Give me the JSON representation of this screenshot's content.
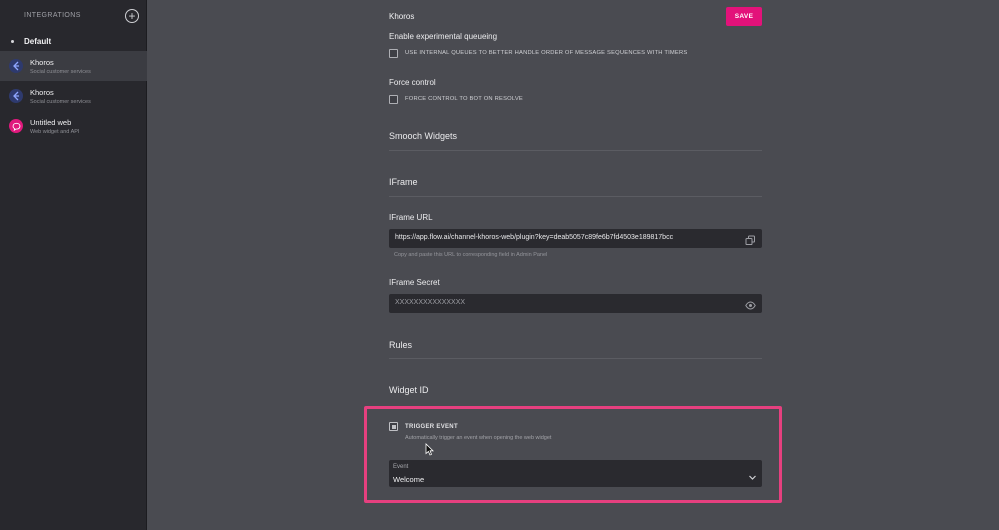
{
  "sidebar": {
    "title": "INTEGRATIONS",
    "add_icon": "plus-circle-icon",
    "group": "Default",
    "items": [
      {
        "name": "Khoros",
        "subtitle": "Social customer services",
        "icon": "khoros-icon",
        "active": true
      },
      {
        "name": "Khoros",
        "subtitle": "Social customer services",
        "icon": "khoros-icon",
        "active": false
      },
      {
        "name": "Untitled web",
        "subtitle": "Web widget and API",
        "icon": "chat-bubble-icon",
        "active": false
      }
    ]
  },
  "header": {
    "title": "Khoros",
    "save_label": "SAVE"
  },
  "queueing": {
    "title": "Enable experimental queueing",
    "checkbox_label": "USE INTERNAL QUEUES TO BETTER HANDLE ORDER OF MESSAGE SEQUENCES WITH TIMERS"
  },
  "force_control": {
    "title": "Force control",
    "checkbox_label": "FORCE CONTROL TO BOT ON RESOLVE"
  },
  "sections": {
    "smooch_widgets": "Smooch Widgets",
    "iframe": "IFrame",
    "rules": "Rules",
    "widget_id": "Widget ID"
  },
  "iframe_url": {
    "label": "IFrame URL",
    "value": "https://app.flow.ai/channel-khoros-web/plugin?key=deab5057c89fe6b7fd4503e189817bcc",
    "hint": "Copy and paste this URL to corresponding field in Admin Panel",
    "icon": "copy-icon"
  },
  "iframe_secret": {
    "label": "IFrame Secret",
    "value": "XXXXXXXXXXXXXXX",
    "icon": "eye-icon"
  },
  "trigger": {
    "title": "TRIGGER EVENT",
    "description": "Automatically trigger an event when opening the web widget"
  },
  "event_select": {
    "label": "Event",
    "value": "Welcome",
    "icon": "chevron-down-icon"
  },
  "colors": {
    "accent": "#e3127a",
    "highlight": "#e6407f",
    "background": "#4a4b51",
    "sidebar": "#28282d"
  }
}
